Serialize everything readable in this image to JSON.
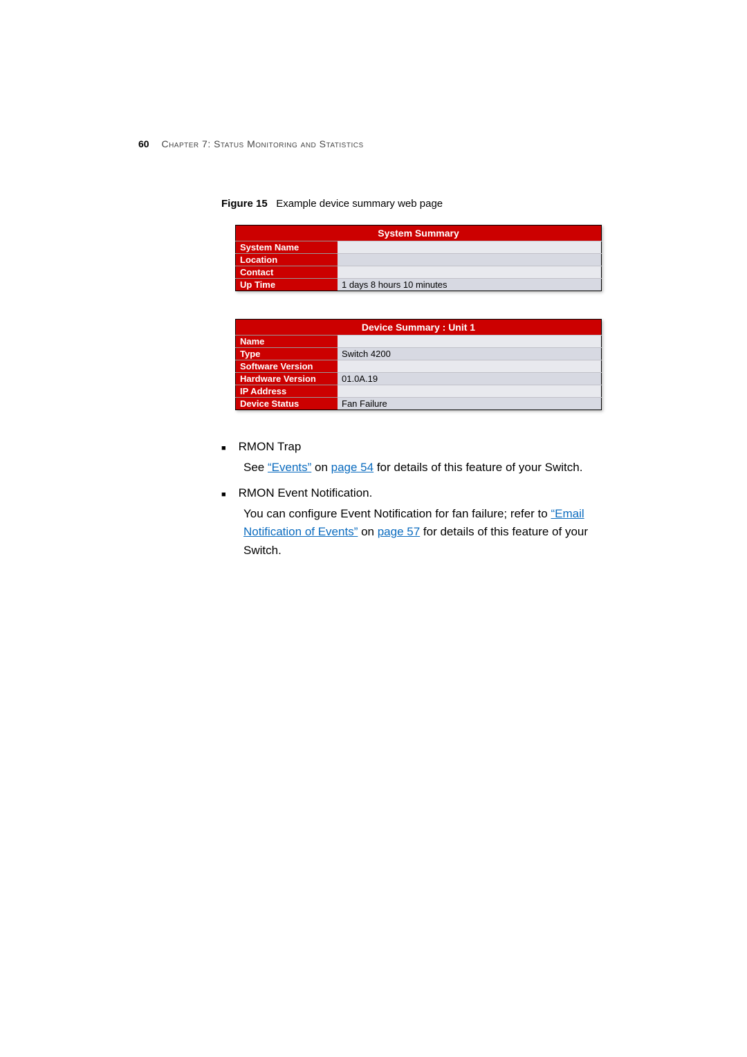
{
  "header": {
    "page_number": "60",
    "chapter_label": "Chapter 7: Status Monitoring and Statistics"
  },
  "figure": {
    "label": "Figure 15",
    "caption": "Example device summary web page"
  },
  "system_summary": {
    "title": "System Summary",
    "rows": [
      {
        "label": "System Name",
        "value": ""
      },
      {
        "label": "Location",
        "value": ""
      },
      {
        "label": "Contact",
        "value": ""
      },
      {
        "label": "Up Time",
        "value": "1 days 8 hours 10 minutes"
      }
    ]
  },
  "device_summary": {
    "title": "Device Summary : Unit 1",
    "rows": [
      {
        "label": "Name",
        "value": ""
      },
      {
        "label": "Type",
        "value": "Switch 4200"
      },
      {
        "label": "Software Version",
        "value": ""
      },
      {
        "label": "Hardware Version",
        "value": "01.0A.19"
      },
      {
        "label": "IP Address",
        "value": ""
      },
      {
        "label": "Device Status",
        "value": "Fan Failure"
      }
    ]
  },
  "bullets": {
    "item1_title": "RMON Trap",
    "item1_body_pre": "See ",
    "item1_link1": "“Events”",
    "item1_body_mid": " on ",
    "item1_link2": "page 54",
    "item1_body_post": " for details of this feature of your Switch.",
    "item2_title": "RMON Event Notification.",
    "item2_body_pre": "You can configure Event Notification for fan failure; refer to ",
    "item2_link1": "“Email Notification of Events”",
    "item2_body_mid": " on ",
    "item2_link2": "page 57",
    "item2_body_post": " for details of this feature of your Switch."
  }
}
